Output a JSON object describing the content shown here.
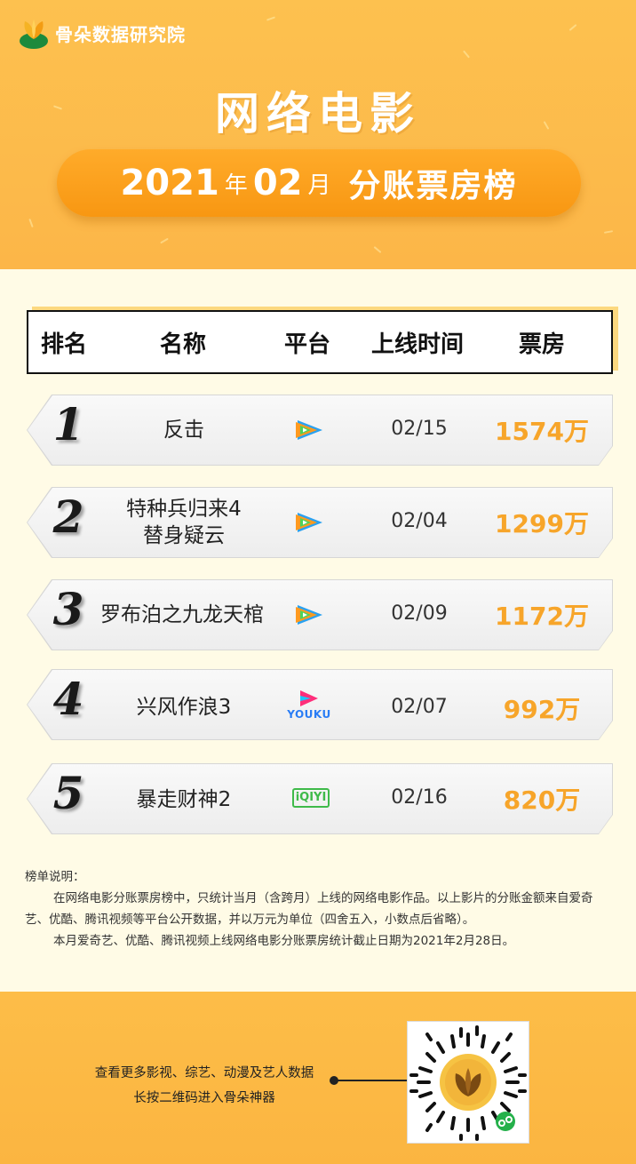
{
  "brand": {
    "logo_icon": "leaf-sprout-icon",
    "name": "骨朵数据研究院"
  },
  "title": {
    "main": "网络电影",
    "year": "2021",
    "year_unit": "年",
    "month": "02",
    "month_unit": "月",
    "label": "分账票房榜"
  },
  "table": {
    "headers": [
      "排名",
      "名称",
      "平台",
      "上线时间",
      "票房"
    ],
    "rows": [
      {
        "rank": "1",
        "name_line1": "反击",
        "name_line2": "",
        "platform": "tencent-video-icon",
        "date": "02/15",
        "box_office": "1574万"
      },
      {
        "rank": "2",
        "name_line1": "特种兵归来4",
        "name_line2": "替身疑云",
        "platform": "tencent-video-icon",
        "date": "02/04",
        "box_office": "1299万"
      },
      {
        "rank": "3",
        "name_line1": "罗布泊之九龙天棺",
        "name_line2": "",
        "platform": "tencent-video-icon",
        "date": "02/09",
        "box_office": "1172万"
      },
      {
        "rank": "4",
        "name_line1": "兴风作浪3",
        "name_line2": "",
        "platform": "youku-icon",
        "date": "02/07",
        "box_office": "992万"
      },
      {
        "rank": "5",
        "name_line1": "暴走财神2",
        "name_line2": "",
        "platform": "iqiyi-icon",
        "date": "02/16",
        "box_office": "820万"
      }
    ],
    "youku_text": "YOUKU",
    "iqiyi_text": "iQIYI"
  },
  "notes": {
    "heading": "榜单说明：",
    "para1": "在网络电影分账票房榜中，只统计当月（含跨月）上线的网络电影作品。以上影片的分账金额来自爱奇艺、优酷、腾讯视频等平台公开数据，并以万元为单位（四舍五入，小数点后省略）。",
    "para2": "本月爱奇艺、优酷、腾讯视频上线网络电影分账票房统计截止日期为2021年2月28日。"
  },
  "footer": {
    "line1": "查看更多影视、综艺、动漫及艺人数据",
    "line2": "长按二维码进入骨朵神器",
    "qr_icon": "mini-program-qr-code"
  },
  "colors": {
    "header_bg": "#fdc14f",
    "accent_orange": "#f89712",
    "box_office": "#f7a52a",
    "page_bg": "#fffbe6"
  }
}
